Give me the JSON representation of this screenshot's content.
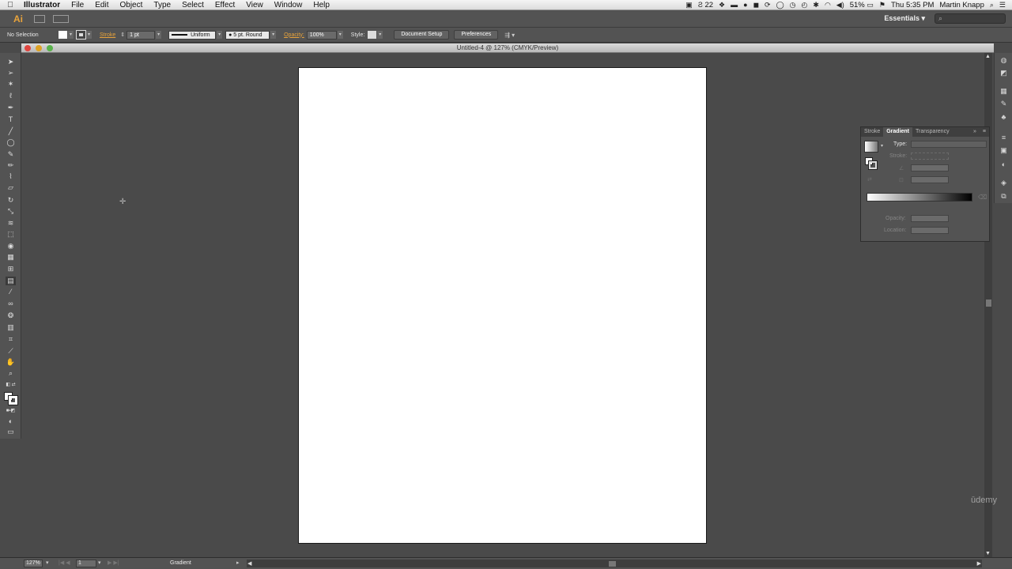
{
  "menubar": {
    "app_name": "Illustrator",
    "items": [
      "File",
      "Edit",
      "Object",
      "Type",
      "Select",
      "Effect",
      "View",
      "Window",
      "Help"
    ],
    "status_number": "22",
    "battery": "51%",
    "clock": "Thu 5:35 PM",
    "user": "Martin Knapp"
  },
  "appbar": {
    "logo": "Ai",
    "workspace": "Essentials",
    "search_icon": "search-icon"
  },
  "controlbar": {
    "selection_label": "No Selection",
    "stroke_label": "Stroke",
    "stroke_weight": "1 pt",
    "stroke_profile": "Uniform",
    "brush": "5 pt. Round",
    "opacity_label": "Opacity:",
    "opacity_value": "100%",
    "style_label": "Style:",
    "document_setup": "Document Setup",
    "preferences": "Preferences"
  },
  "document": {
    "title": "Untitled-4 @ 127% (CMYK/Preview)"
  },
  "gradient_panel": {
    "tabs": [
      "Stroke",
      "Gradient",
      "Transparency"
    ],
    "type_label": "Type:",
    "stroke_label": "Stroke:",
    "opacity_label": "Opacity:",
    "location_label": "Location:"
  },
  "statusbar": {
    "zoom": "127%",
    "artboard_number": "1",
    "tool_name": "Gradient"
  },
  "watermark": "ūdemy",
  "colors": {
    "ui_dark": "#535353",
    "canvas": "#4a4a4a",
    "artboard": "#ffffff",
    "accent_orange": "#e8a33b"
  }
}
